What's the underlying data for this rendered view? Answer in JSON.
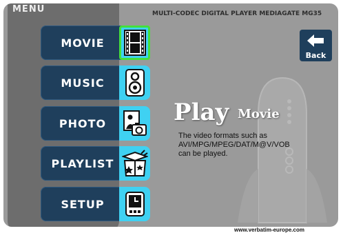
{
  "header": {
    "menu_label": "MENU",
    "device_title": "MULTI-CODEC DIGITAL PLAYER MEDIAGATE MG35"
  },
  "menu": {
    "items": [
      {
        "label": "MOVIE",
        "icon": "film-strip-icon",
        "selected": true
      },
      {
        "label": "MUSIC",
        "icon": "speaker-icon",
        "selected": false
      },
      {
        "label": "PHOTO",
        "icon": "photo-camera-icon",
        "selected": false
      },
      {
        "label": "PLAYLIST",
        "icon": "gift-box-icon",
        "selected": false
      },
      {
        "label": "SETUP",
        "icon": "clock-icon",
        "selected": false
      }
    ]
  },
  "back_button": {
    "label": "Back",
    "icon": "back-arrow-icon"
  },
  "info": {
    "play_word": "Play",
    "play_target": "Movie",
    "description_lines": [
      "The video formats such as",
      "AVI/MPG/MPEG/DAT/M@V/VOB",
      "can be played."
    ]
  },
  "footer": {
    "url": "www.verbatim-europe.com"
  },
  "colors": {
    "button_blue": "#1f3f5c",
    "icon_cyan": "#3fd1f2",
    "selected_green": "#44e03a",
    "background_gray": "#9a9a9a",
    "menu_panel_gray": "#6d6d6d"
  }
}
